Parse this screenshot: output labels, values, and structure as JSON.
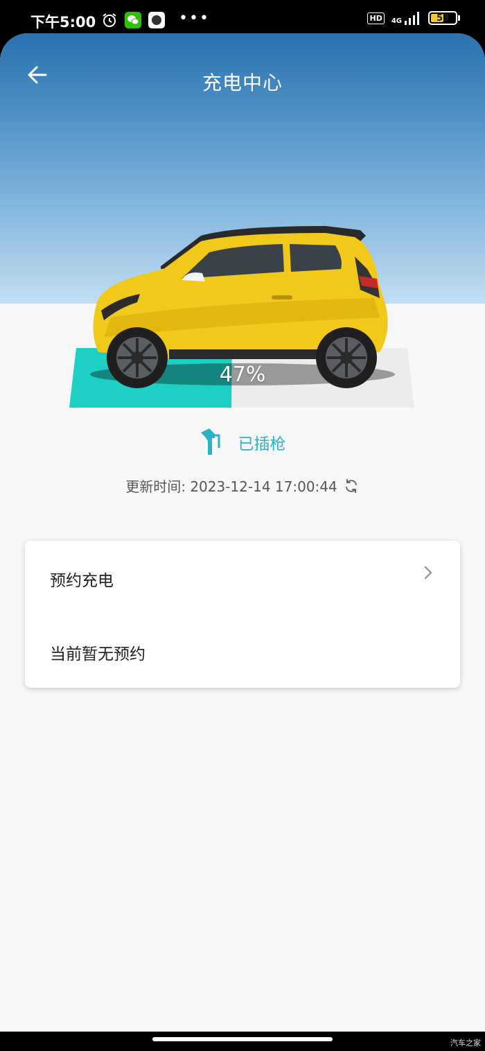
{
  "status_bar": {
    "time": "下午5:00",
    "hd": "HD",
    "network": "4G",
    "battery_level": 53,
    "battery_text": "53",
    "icons": [
      "alarm-icon",
      "wechat-icon",
      "app-icon",
      "more-dots"
    ]
  },
  "header": {
    "title": "充电中心",
    "back_icon": "arrow-left-icon"
  },
  "charging": {
    "percent_text": "47%",
    "percent": 47,
    "plug_status": "已插枪",
    "update_label": "更新时间: 2023-12-14 17:00:44"
  },
  "reservation_card": {
    "title": "预约充电",
    "status": "当前暂无预约"
  },
  "footer": {
    "watermark": "汽车之家"
  },
  "colors": {
    "accent": "#28b4c6",
    "charge_fill": "#1ecfc3",
    "car_body": "#f0c91a",
    "header_top": "#2a73b0"
  }
}
